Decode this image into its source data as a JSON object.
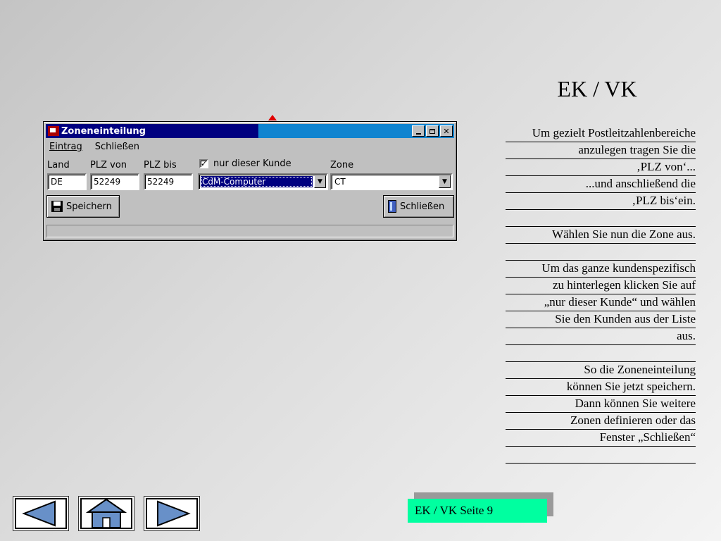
{
  "window": {
    "title": "Zoneneinteilung",
    "menu": [
      "Eintrag",
      "Schließen"
    ],
    "labels": {
      "land": "Land",
      "plz_von": "PLZ von",
      "plz_bis": "PLZ bis",
      "nur_kunde": "nur dieser Kunde",
      "zone": "Zone"
    },
    "fields": {
      "land": "DE",
      "plz_von": "52249",
      "plz_bis": "52249",
      "kunde": "CdM-Computer",
      "zone": "CT"
    },
    "checkbox_checked": true,
    "buttons": {
      "save": "Speichern",
      "close": "Schließen"
    }
  },
  "slide": {
    "title": "EK / VK",
    "notes": [
      "Um gezielt Postleitzahlenbereiche",
      "anzulegen tragen Sie die",
      "‚PLZ von‘...",
      "...und anschließend die",
      "‚PLZ bis‘ein.",
      "",
      "Wählen Sie nun die Zone aus.",
      "",
      "Um das ganze kundenspezifisch",
      "zu hinterlegen klicken Sie auf",
      "„nur dieser Kunde“ und wählen",
      "Sie den Kunden aus der Liste",
      "aus.",
      "",
      "So die Zoneneinteilung",
      "können Sie jetzt speichern.",
      "Dann können Sie weitere",
      "Zonen definieren oder das",
      "Fenster „Schließen“",
      ""
    ],
    "page_label": "EK / VK Seite 9"
  },
  "icons": {
    "back": "back-arrow-icon",
    "home": "home-icon",
    "forward": "forward-arrow-icon"
  },
  "colors": {
    "titlebar": "#000080",
    "nav_fill": "#6890c8",
    "page_label_bg": "#00ffa0"
  }
}
